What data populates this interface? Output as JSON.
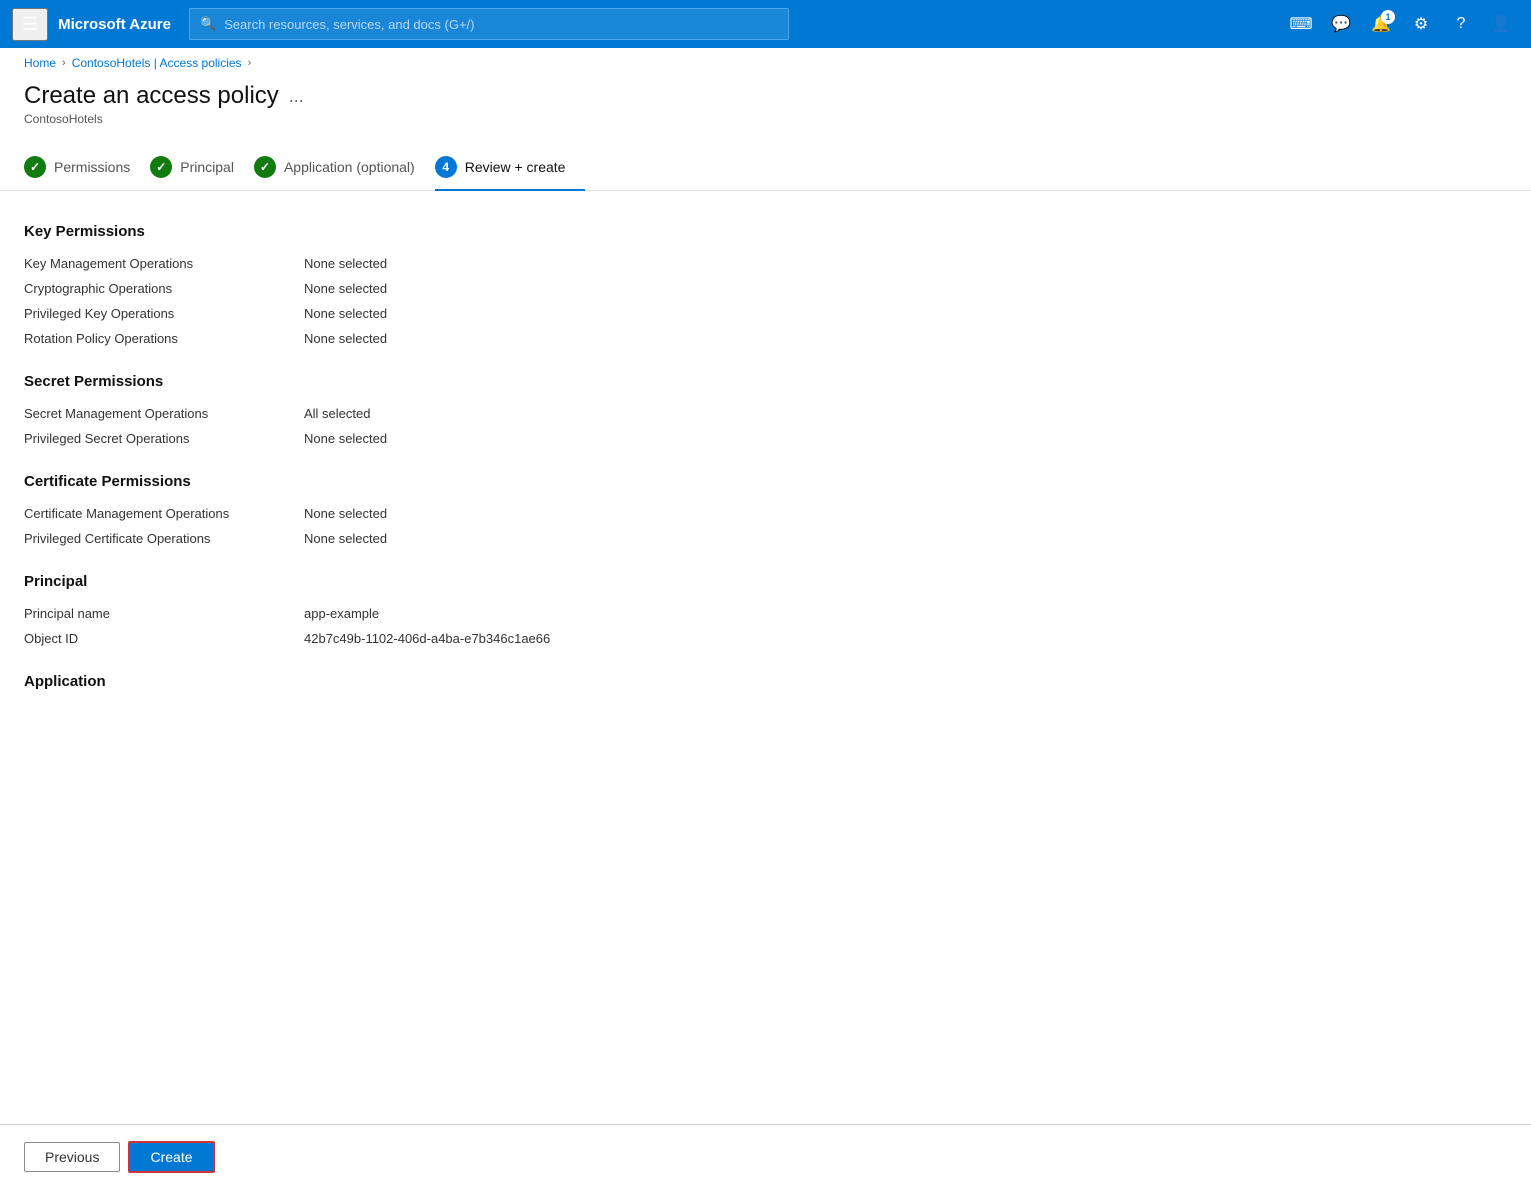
{
  "topbar": {
    "logo": "Microsoft Azure",
    "search_placeholder": "Search resources, services, and docs (G+/)",
    "notification_count": "1"
  },
  "breadcrumb": {
    "home": "Home",
    "parent": "ContosoHotels | Access policies",
    "separator": "›"
  },
  "page": {
    "title": "Create an access policy",
    "subtitle": "ContosoHotels",
    "dots": "..."
  },
  "wizard": {
    "steps": [
      {
        "id": "permissions",
        "label": "Permissions",
        "state": "completed",
        "number": "✓"
      },
      {
        "id": "principal",
        "label": "Principal",
        "state": "completed",
        "number": "✓"
      },
      {
        "id": "application",
        "label": "Application (optional)",
        "state": "completed",
        "number": "✓"
      },
      {
        "id": "review",
        "label": "Review + create",
        "state": "active",
        "number": "4"
      }
    ]
  },
  "sections": [
    {
      "title": "Key Permissions",
      "rows": [
        {
          "label": "Key Management Operations",
          "value": "None selected"
        },
        {
          "label": "Cryptographic Operations",
          "value": "None selected"
        },
        {
          "label": "Privileged Key Operations",
          "value": "None selected"
        },
        {
          "label": "Rotation Policy Operations",
          "value": "None selected"
        }
      ]
    },
    {
      "title": "Secret Permissions",
      "rows": [
        {
          "label": "Secret Management Operations",
          "value": "All selected"
        },
        {
          "label": "Privileged Secret Operations",
          "value": "None selected"
        }
      ]
    },
    {
      "title": "Certificate Permissions",
      "rows": [
        {
          "label": "Certificate Management Operations",
          "value": "None selected"
        },
        {
          "label": "Privileged Certificate Operations",
          "value": "None selected"
        }
      ]
    },
    {
      "title": "Principal",
      "rows": [
        {
          "label": "Principal name",
          "value": "app-example"
        },
        {
          "label": "Object ID",
          "value": "42b7c49b-1102-406d-a4ba-e7b346c1ae66"
        }
      ]
    },
    {
      "title": "Application",
      "rows": []
    }
  ],
  "actions": {
    "previous": "Previous",
    "create": "Create"
  }
}
